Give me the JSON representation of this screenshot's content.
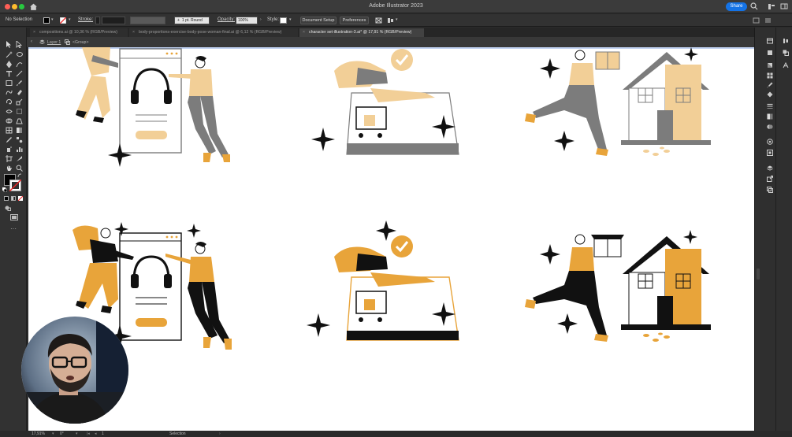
{
  "window": {
    "title": "Adobe Illustrator 2023",
    "share_label": "Share"
  },
  "control_bar": {
    "selection_label": "No Selection",
    "stroke_label": "Stroke:",
    "brush_value": "1 pt. Round",
    "opacity_label": "Opacity:",
    "opacity_value": "100%",
    "style_label": "Style:",
    "document_setup_label": "Document Setup",
    "preferences_label": "Preferences"
  },
  "tabs": [
    {
      "label": "compositions.ai @ 10,36 % (RGB/Preview)",
      "active": false
    },
    {
      "label": "body-proportions-exercise-body-pose-woman-final.ai @ 6,12 % (RGB/Preview)",
      "active": false
    },
    {
      "label": "character set-illustration-3.ai* @ 17,91 % (RGB/Preview)",
      "active": true
    }
  ],
  "breadcrumb": {
    "layer": "Layer 1",
    "group": "<Group>"
  },
  "status_bar": {
    "zoom": "17,91%",
    "rotation": "0°",
    "artboard": "1",
    "tool": "Selection"
  },
  "colors": {
    "accent_orange": "#e8a43a",
    "accent_light_orange": "#f2cf97",
    "mute_gray": "#7c7c7c",
    "ink": "#111111",
    "canvas": "#ffffff",
    "ui_dark": "#323232",
    "share_blue": "#1473e6"
  }
}
